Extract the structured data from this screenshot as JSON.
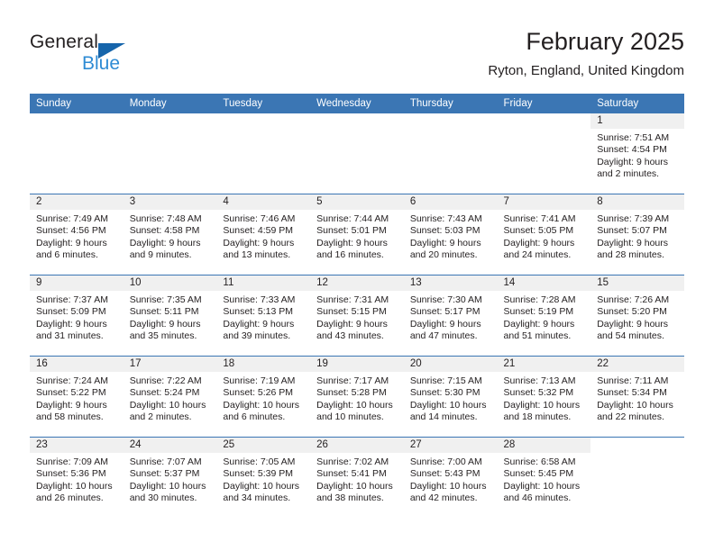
{
  "brand": {
    "name_part1": "General",
    "name_part2": "Blue",
    "flag_icon": "triangle-flag-icon"
  },
  "header": {
    "title": "February 2025",
    "subtitle": "Ryton, England, United Kingdom"
  },
  "colors": {
    "header_blue": "#3b76b4",
    "daynum_band": "#f0f0f0",
    "brand_dark": "#231f20",
    "brand_blue": "#2e8bd4",
    "flag_blue": "#1665ab"
  },
  "weekday_headers": [
    "Sunday",
    "Monday",
    "Tuesday",
    "Wednesday",
    "Thursday",
    "Friday",
    "Saturday"
  ],
  "weeks": [
    [
      {
        "day": "",
        "empty": true
      },
      {
        "day": "",
        "empty": true
      },
      {
        "day": "",
        "empty": true
      },
      {
        "day": "",
        "empty": true
      },
      {
        "day": "",
        "empty": true
      },
      {
        "day": "",
        "empty": true
      },
      {
        "day": "1",
        "sunrise": "Sunrise: 7:51 AM",
        "sunset": "Sunset: 4:54 PM",
        "daylight": "Daylight: 9 hours and 2 minutes."
      }
    ],
    [
      {
        "day": "2",
        "sunrise": "Sunrise: 7:49 AM",
        "sunset": "Sunset: 4:56 PM",
        "daylight": "Daylight: 9 hours and 6 minutes."
      },
      {
        "day": "3",
        "sunrise": "Sunrise: 7:48 AM",
        "sunset": "Sunset: 4:58 PM",
        "daylight": "Daylight: 9 hours and 9 minutes."
      },
      {
        "day": "4",
        "sunrise": "Sunrise: 7:46 AM",
        "sunset": "Sunset: 4:59 PM",
        "daylight": "Daylight: 9 hours and 13 minutes."
      },
      {
        "day": "5",
        "sunrise": "Sunrise: 7:44 AM",
        "sunset": "Sunset: 5:01 PM",
        "daylight": "Daylight: 9 hours and 16 minutes."
      },
      {
        "day": "6",
        "sunrise": "Sunrise: 7:43 AM",
        "sunset": "Sunset: 5:03 PM",
        "daylight": "Daylight: 9 hours and 20 minutes."
      },
      {
        "day": "7",
        "sunrise": "Sunrise: 7:41 AM",
        "sunset": "Sunset: 5:05 PM",
        "daylight": "Daylight: 9 hours and 24 minutes."
      },
      {
        "day": "8",
        "sunrise": "Sunrise: 7:39 AM",
        "sunset": "Sunset: 5:07 PM",
        "daylight": "Daylight: 9 hours and 28 minutes."
      }
    ],
    [
      {
        "day": "9",
        "sunrise": "Sunrise: 7:37 AM",
        "sunset": "Sunset: 5:09 PM",
        "daylight": "Daylight: 9 hours and 31 minutes."
      },
      {
        "day": "10",
        "sunrise": "Sunrise: 7:35 AM",
        "sunset": "Sunset: 5:11 PM",
        "daylight": "Daylight: 9 hours and 35 minutes."
      },
      {
        "day": "11",
        "sunrise": "Sunrise: 7:33 AM",
        "sunset": "Sunset: 5:13 PM",
        "daylight": "Daylight: 9 hours and 39 minutes."
      },
      {
        "day": "12",
        "sunrise": "Sunrise: 7:31 AM",
        "sunset": "Sunset: 5:15 PM",
        "daylight": "Daylight: 9 hours and 43 minutes."
      },
      {
        "day": "13",
        "sunrise": "Sunrise: 7:30 AM",
        "sunset": "Sunset: 5:17 PM",
        "daylight": "Daylight: 9 hours and 47 minutes."
      },
      {
        "day": "14",
        "sunrise": "Sunrise: 7:28 AM",
        "sunset": "Sunset: 5:19 PM",
        "daylight": "Daylight: 9 hours and 51 minutes."
      },
      {
        "day": "15",
        "sunrise": "Sunrise: 7:26 AM",
        "sunset": "Sunset: 5:20 PM",
        "daylight": "Daylight: 9 hours and 54 minutes."
      }
    ],
    [
      {
        "day": "16",
        "sunrise": "Sunrise: 7:24 AM",
        "sunset": "Sunset: 5:22 PM",
        "daylight": "Daylight: 9 hours and 58 minutes."
      },
      {
        "day": "17",
        "sunrise": "Sunrise: 7:22 AM",
        "sunset": "Sunset: 5:24 PM",
        "daylight": "Daylight: 10 hours and 2 minutes."
      },
      {
        "day": "18",
        "sunrise": "Sunrise: 7:19 AM",
        "sunset": "Sunset: 5:26 PM",
        "daylight": "Daylight: 10 hours and 6 minutes."
      },
      {
        "day": "19",
        "sunrise": "Sunrise: 7:17 AM",
        "sunset": "Sunset: 5:28 PM",
        "daylight": "Daylight: 10 hours and 10 minutes."
      },
      {
        "day": "20",
        "sunrise": "Sunrise: 7:15 AM",
        "sunset": "Sunset: 5:30 PM",
        "daylight": "Daylight: 10 hours and 14 minutes."
      },
      {
        "day": "21",
        "sunrise": "Sunrise: 7:13 AM",
        "sunset": "Sunset: 5:32 PM",
        "daylight": "Daylight: 10 hours and 18 minutes."
      },
      {
        "day": "22",
        "sunrise": "Sunrise: 7:11 AM",
        "sunset": "Sunset: 5:34 PM",
        "daylight": "Daylight: 10 hours and 22 minutes."
      }
    ],
    [
      {
        "day": "23",
        "sunrise": "Sunrise: 7:09 AM",
        "sunset": "Sunset: 5:36 PM",
        "daylight": "Daylight: 10 hours and 26 minutes."
      },
      {
        "day": "24",
        "sunrise": "Sunrise: 7:07 AM",
        "sunset": "Sunset: 5:37 PM",
        "daylight": "Daylight: 10 hours and 30 minutes."
      },
      {
        "day": "25",
        "sunrise": "Sunrise: 7:05 AM",
        "sunset": "Sunset: 5:39 PM",
        "daylight": "Daylight: 10 hours and 34 minutes."
      },
      {
        "day": "26",
        "sunrise": "Sunrise: 7:02 AM",
        "sunset": "Sunset: 5:41 PM",
        "daylight": "Daylight: 10 hours and 38 minutes."
      },
      {
        "day": "27",
        "sunrise": "Sunrise: 7:00 AM",
        "sunset": "Sunset: 5:43 PM",
        "daylight": "Daylight: 10 hours and 42 minutes."
      },
      {
        "day": "28",
        "sunrise": "Sunrise: 6:58 AM",
        "sunset": "Sunset: 5:45 PM",
        "daylight": "Daylight: 10 hours and 46 minutes."
      },
      {
        "day": "",
        "empty": true
      }
    ]
  ]
}
